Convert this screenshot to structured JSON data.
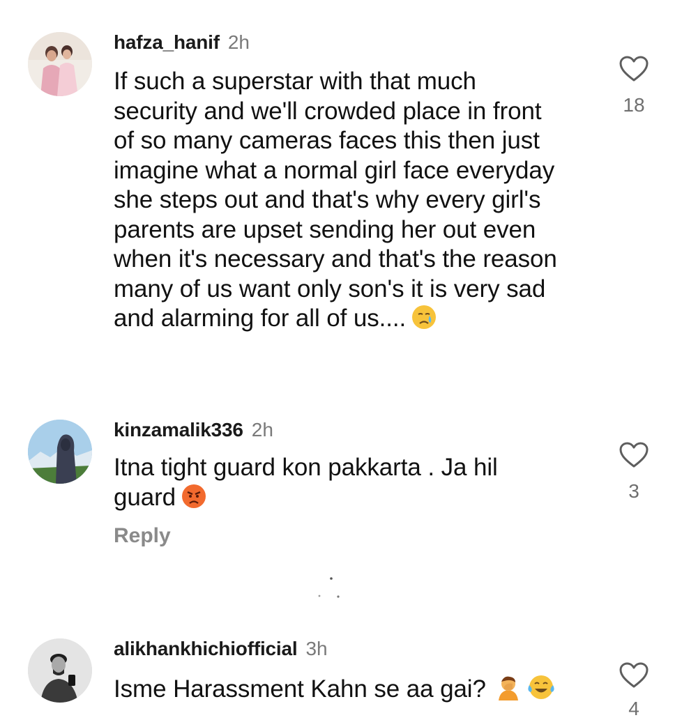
{
  "comments": [
    {
      "username": "hafza_hanif",
      "time": "2h",
      "lines": [
        "If such a superstar with that much",
        "security and we'll crowded place in front",
        "of so many cameras faces this  then just",
        "imagine what a normal girl  face everyday",
        "she steps out and that's why every girl's",
        "parents are upset sending her out even",
        "when it's necessary and that's the reason",
        "many of us want only son's it is very sad",
        "and alarming for all of us...."
      ],
      "emoji": [
        "crying-face-emoji"
      ],
      "likes": "18",
      "icon": "heart-outline-icon"
    },
    {
      "username": "kinzamalik336",
      "time": "2h",
      "lines": [
        "Itna tight guard kon pakkarta . Ja hil",
        "guard"
      ],
      "emoji": [
        "angry-face-emoji"
      ],
      "reply_label": "Reply",
      "likes": "3",
      "icon": "heart-outline-icon"
    },
    {
      "username": "alikhankhichiofficial",
      "time": "3h",
      "lines": [
        "Isme Harassment Kahn se aa gai?"
      ],
      "emoji": [
        "person-facepalming-emoji",
        "tears-of-joy-emoji"
      ],
      "likes": "4",
      "icon": "heart-outline-icon"
    }
  ],
  "colors": {
    "text": "#111111",
    "muted": "#7a7a7a",
    "reply": "#8a8a8a",
    "emoji_yellow": "#f7c33b",
    "emoji_angry": "#f26a2e"
  }
}
